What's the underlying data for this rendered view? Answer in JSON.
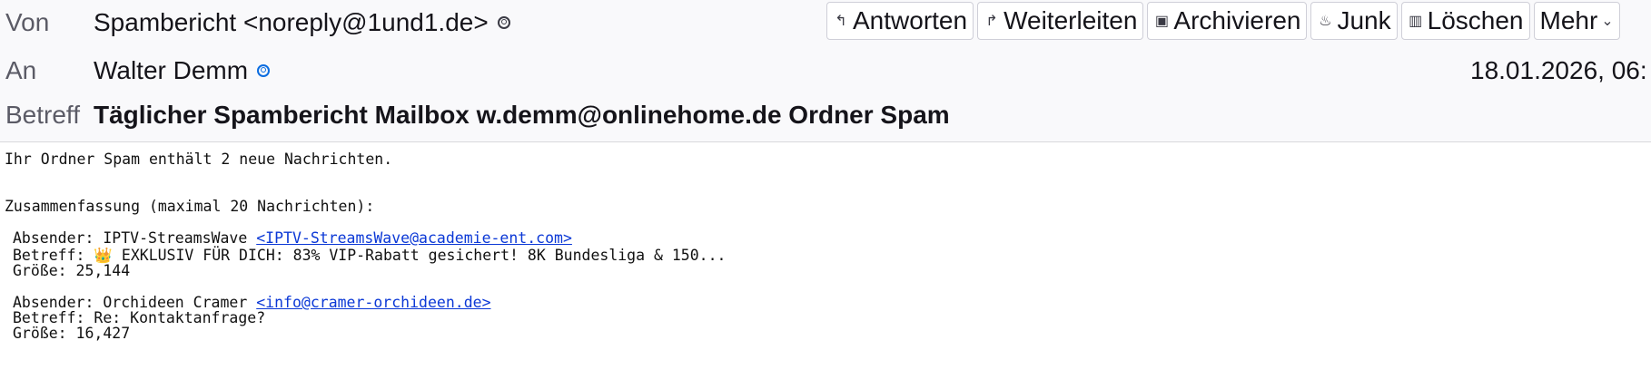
{
  "header": {
    "from": {
      "label": "Von",
      "value": "Spambericht <noreply@1und1.de>"
    },
    "to": {
      "label": "An",
      "value": "Walter Demm"
    },
    "date": "18.01.2026, 06:",
    "subject": {
      "label": "Betreff",
      "value": "Täglicher Spambericht Mailbox w.demm@onlinehome.de Ordner Spam"
    }
  },
  "toolbar": {
    "reply": "Antworten",
    "forward": "Weiterleiten",
    "archive": "Archivieren",
    "junk": "Junk",
    "delete": "Löschen",
    "more": "Mehr"
  },
  "body": {
    "intro": "Ihr Ordner Spam enthält 2 neue Nachrichten.",
    "summary": "Zusammenfassung (maximal 20 Nachrichten):",
    "messages": [
      {
        "sender_prefix": "Absender: IPTV-StreamsWave ",
        "sender_email": "<IPTV-StreamsWave@academie-ent.com>",
        "subject_prefix": "Betreff: ",
        "subject_emoji": "👑",
        "subject_text": " EXKLUSIV FÜR DICH: 83% VIP-Rabatt gesichert! 8K Bundesliga & 150...",
        "size": "Größe: 25,144"
      },
      {
        "sender_prefix": "Absender: Orchideen Cramer ",
        "sender_email": "<info@cramer-orchideen.de>",
        "subject_prefix": "Betreff: ",
        "subject_emoji": "",
        "subject_text": "Re: Kontaktanfrage?",
        "size": "Größe: 16,427"
      }
    ]
  },
  "icons": {
    "reply": "reply-icon",
    "forward": "forward-icon",
    "archive": "archive-icon",
    "junk": "junk-icon",
    "delete": "trash-icon",
    "more": "chevron-down-icon",
    "contact": "contact-icon"
  },
  "colors": {
    "link": "#0b38d6",
    "header_bg": "#f9f9fb",
    "contact_known": "#0a6ce0"
  }
}
